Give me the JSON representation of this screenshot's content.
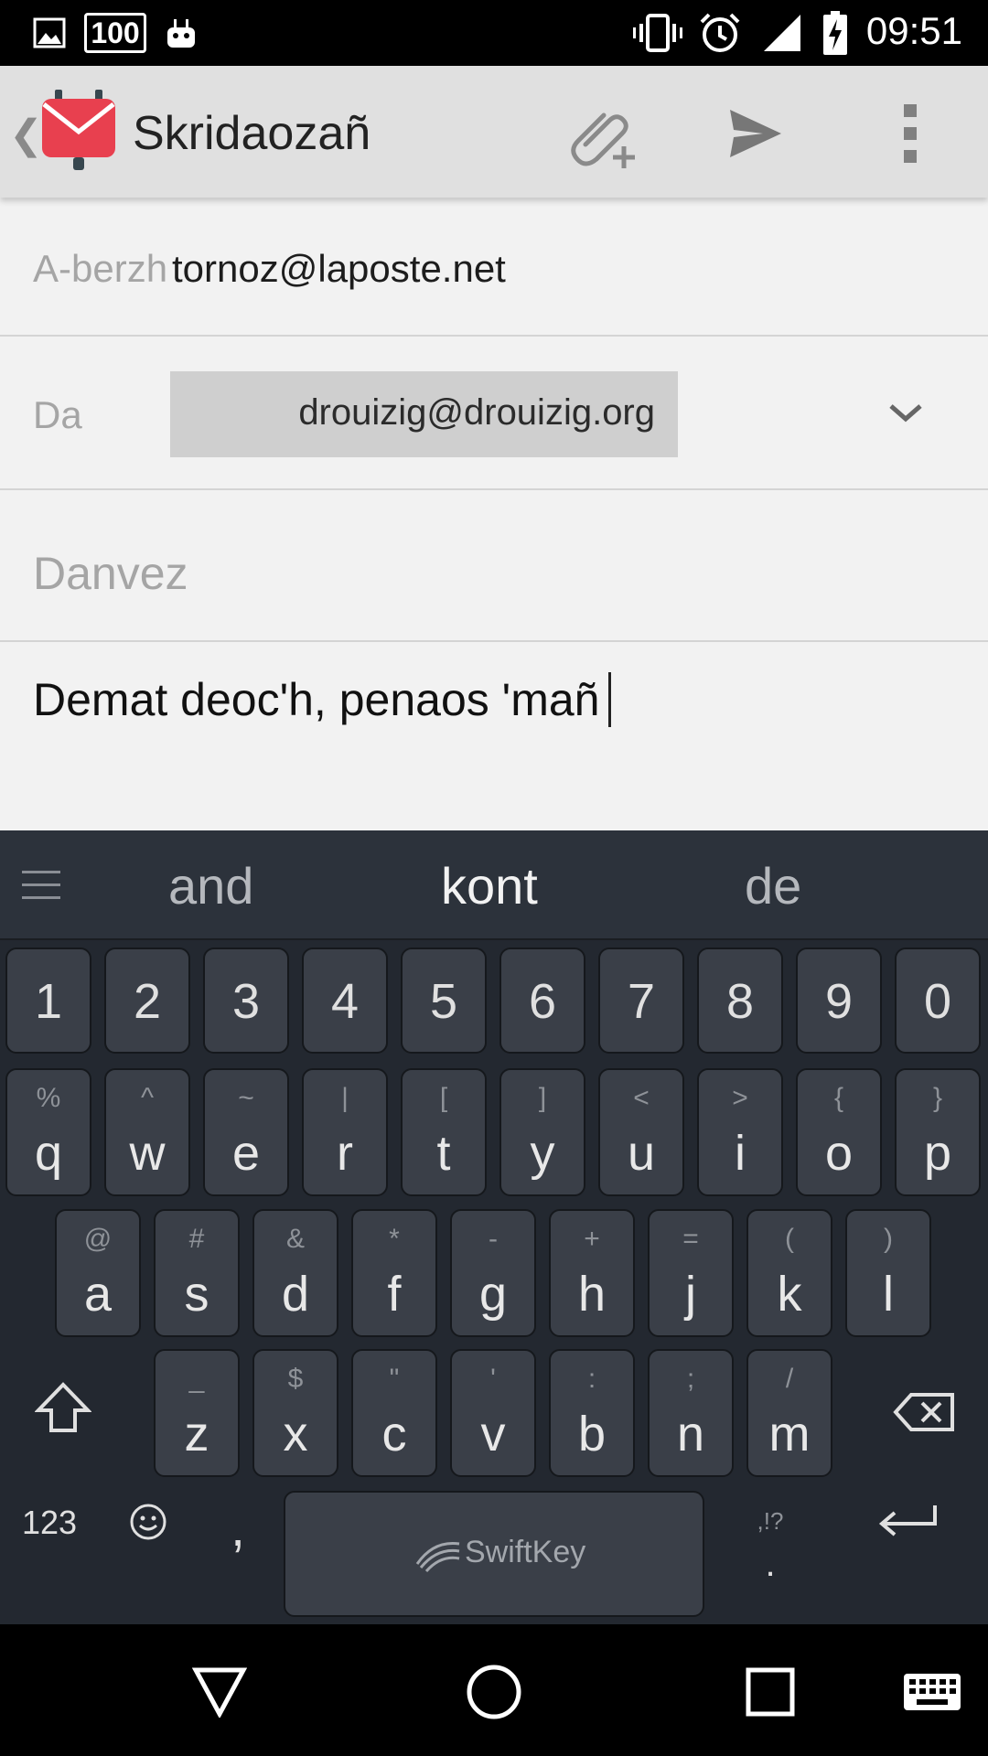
{
  "status_bar": {
    "time": "09:51",
    "badge_100": "100",
    "icons": [
      "image-icon",
      "badge-100-icon",
      "android-icon",
      "vibrate-icon",
      "alarm-icon",
      "signal-icon",
      "battery-charging-icon"
    ]
  },
  "app_bar": {
    "title": "Skridaozañ",
    "actions": [
      "attach-icon",
      "send-icon",
      "overflow-menu-icon"
    ]
  },
  "form": {
    "from_label": "A-berzh",
    "from_value": "tornoz@laposte.net",
    "to_label": "Da",
    "to_chip": "drouizig@drouizig.org",
    "subject_placeholder": "Danvez",
    "body_text": "Demat deoc'h, penaos 'mañ"
  },
  "keyboard": {
    "suggestions": [
      "and",
      "kont",
      "de"
    ],
    "number_row": [
      "1",
      "2",
      "3",
      "4",
      "5",
      "6",
      "7",
      "8",
      "9",
      "0"
    ],
    "row1": [
      {
        "main": "q",
        "sec": "%"
      },
      {
        "main": "w",
        "sec": "^"
      },
      {
        "main": "e",
        "sec": "~"
      },
      {
        "main": "r",
        "sec": "|"
      },
      {
        "main": "t",
        "sec": "["
      },
      {
        "main": "y",
        "sec": "]"
      },
      {
        "main": "u",
        "sec": "<"
      },
      {
        "main": "i",
        "sec": ">"
      },
      {
        "main": "o",
        "sec": "{"
      },
      {
        "main": "p",
        "sec": "}"
      }
    ],
    "row2": [
      {
        "main": "a",
        "sec": "@"
      },
      {
        "main": "s",
        "sec": "#"
      },
      {
        "main": "d",
        "sec": "&"
      },
      {
        "main": "f",
        "sec": "*"
      },
      {
        "main": "g",
        "sec": "-"
      },
      {
        "main": "h",
        "sec": "+"
      },
      {
        "main": "j",
        "sec": "="
      },
      {
        "main": "k",
        "sec": "("
      },
      {
        "main": "l",
        "sec": ")"
      }
    ],
    "row3": [
      {
        "main": "z",
        "sec": "_"
      },
      {
        "main": "x",
        "sec": "$"
      },
      {
        "main": "c",
        "sec": "\""
      },
      {
        "main": "v",
        "sec": "'"
      },
      {
        "main": "b",
        "sec": ":"
      },
      {
        "main": "n",
        "sec": ";"
      },
      {
        "main": "m",
        "sec": "/"
      }
    ],
    "numbers_key": "123",
    "comma_key": ",",
    "period_key": ".",
    "period_sec": ",!?",
    "space_label": "SwiftKey"
  },
  "colors": {
    "status_bar": "#000000",
    "app_bar": "#e0e0e0",
    "keyboard_bg": "#232830",
    "key_bg": "#3a3f48",
    "chip_bg": "#cfcfcf",
    "app_icon_red": "#e8404f"
  }
}
